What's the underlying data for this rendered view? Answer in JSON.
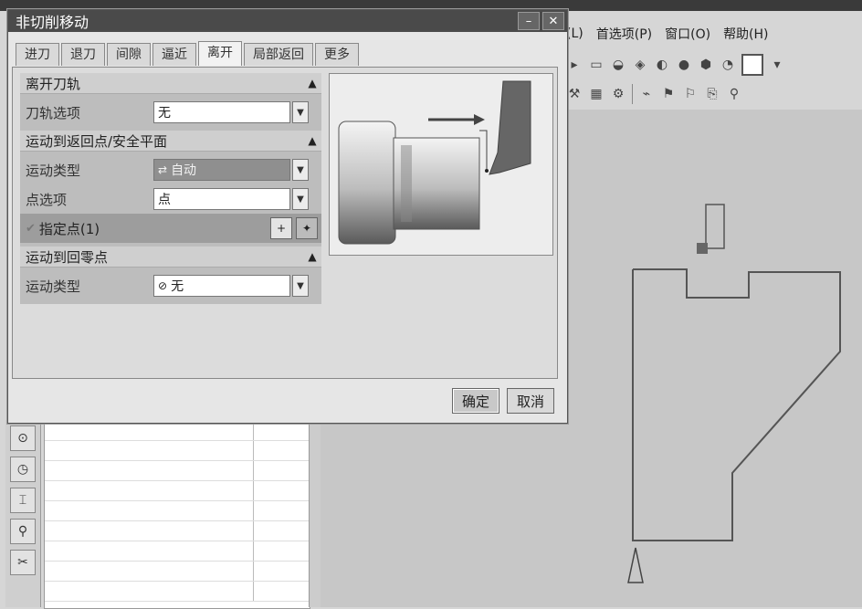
{
  "menubar": {
    "items": [
      "(L)",
      "首选项(P)",
      "窗口(O)",
      "帮助(H)"
    ]
  },
  "dialog": {
    "title": "非切削移动",
    "tabs": [
      "进刀",
      "退刀",
      "间隙",
      "逼近",
      "离开",
      "局部返回",
      "更多"
    ],
    "active_tab": "离开",
    "groups": {
      "leave_path": {
        "title": "离开刀轨",
        "rows": [
          {
            "label": "刀轨选项",
            "value": "无"
          }
        ]
      },
      "return_safe": {
        "title": "运动到返回点/安全平面",
        "rows": [
          {
            "label": "运动类型",
            "value": "自动",
            "icon": "auto-icon"
          },
          {
            "label": "点选项",
            "value": "点"
          }
        ],
        "specify_point": "指定点(1)"
      },
      "return_home": {
        "title": "运动到回零点",
        "rows": [
          {
            "label": "运动类型",
            "value": "无",
            "icon": "none-icon"
          }
        ]
      }
    },
    "buttons": {
      "ok": "确定",
      "cancel": "取消"
    }
  }
}
